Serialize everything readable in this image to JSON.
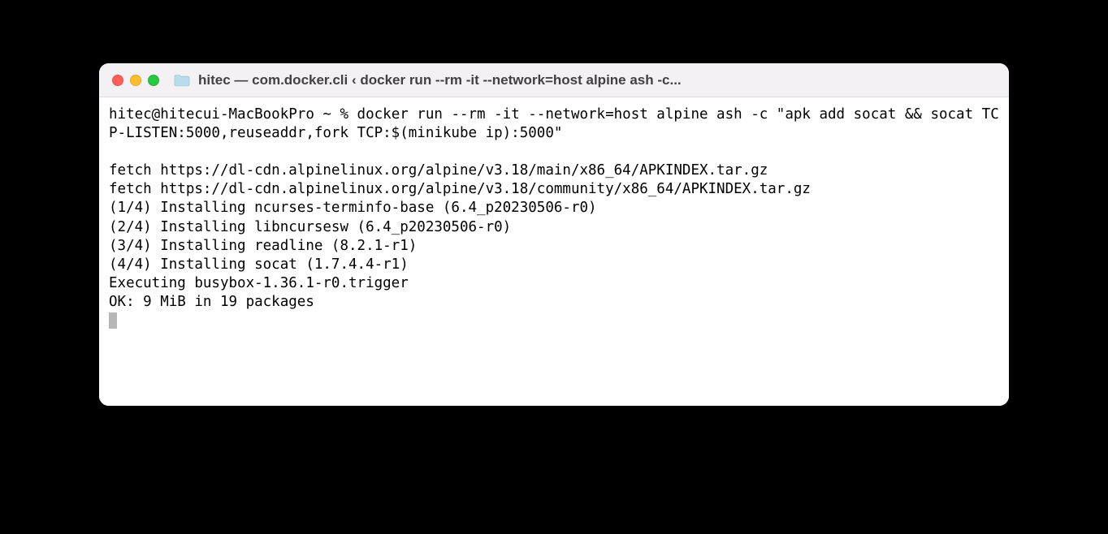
{
  "window": {
    "title": "hitec — com.docker.cli ‹ docker run --rm -it --network=host alpine ash -c...",
    "traffic": {
      "close": "close-button",
      "minimize": "minimize-button",
      "maximize": "maximize-button"
    }
  },
  "terminal": {
    "prompt": "hitec@hitecui-MacBookPro ~ % ",
    "command": "docker run --rm -it --network=host alpine ash -c \"apk add socat && socat TCP-LISTEN:5000,reuseaddr,fork TCP:$(minikube ip):5000\"",
    "output_lines": [
      "",
      "fetch https://dl-cdn.alpinelinux.org/alpine/v3.18/main/x86_64/APKINDEX.tar.gz",
      "fetch https://dl-cdn.alpinelinux.org/alpine/v3.18/community/x86_64/APKINDEX.tar.gz",
      "(1/4) Installing ncurses-terminfo-base (6.4_p20230506-r0)",
      "(2/4) Installing libncursesw (6.4_p20230506-r0)",
      "(3/4) Installing readline (8.2.1-r1)",
      "(4/4) Installing socat (1.7.4.4-r1)",
      "Executing busybox-1.36.1-r0.trigger",
      "OK: 9 MiB in 19 packages"
    ]
  }
}
